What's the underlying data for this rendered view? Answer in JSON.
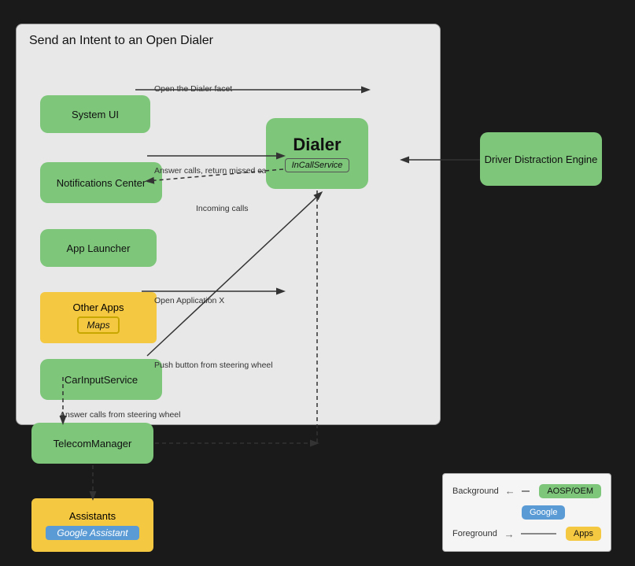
{
  "title": "Send an Intent to an Open Dialer",
  "boxes": {
    "system_ui": "System UI",
    "notifications_center": "Notifications Center",
    "app_launcher": "App Launcher",
    "other_apps": "Other Apps",
    "maps": "Maps",
    "car_input": "CarInputService",
    "telecom_manager": "TelecomManager",
    "assistants": "Assistants",
    "google_assistant": "Google Assistant",
    "dialer": "Dialer",
    "incall": "InCallService",
    "dde": "Driver Distraction Engine"
  },
  "arrow_labels": {
    "open_dialer_facet": "Open the Dialer facet",
    "answer_calls": "Answer calls, return missed calls",
    "incoming_calls": "Incoming calls",
    "open_app_x": "Open Application X",
    "push_button": "Push button from steering wheel",
    "answer_steering": "Answer calls from steering wheel"
  },
  "legend": {
    "background_label": "Background",
    "foreground_label": "Foreground",
    "aosp_label": "AOSP/OEM",
    "google_label": "Google",
    "apps_label": "Apps"
  }
}
